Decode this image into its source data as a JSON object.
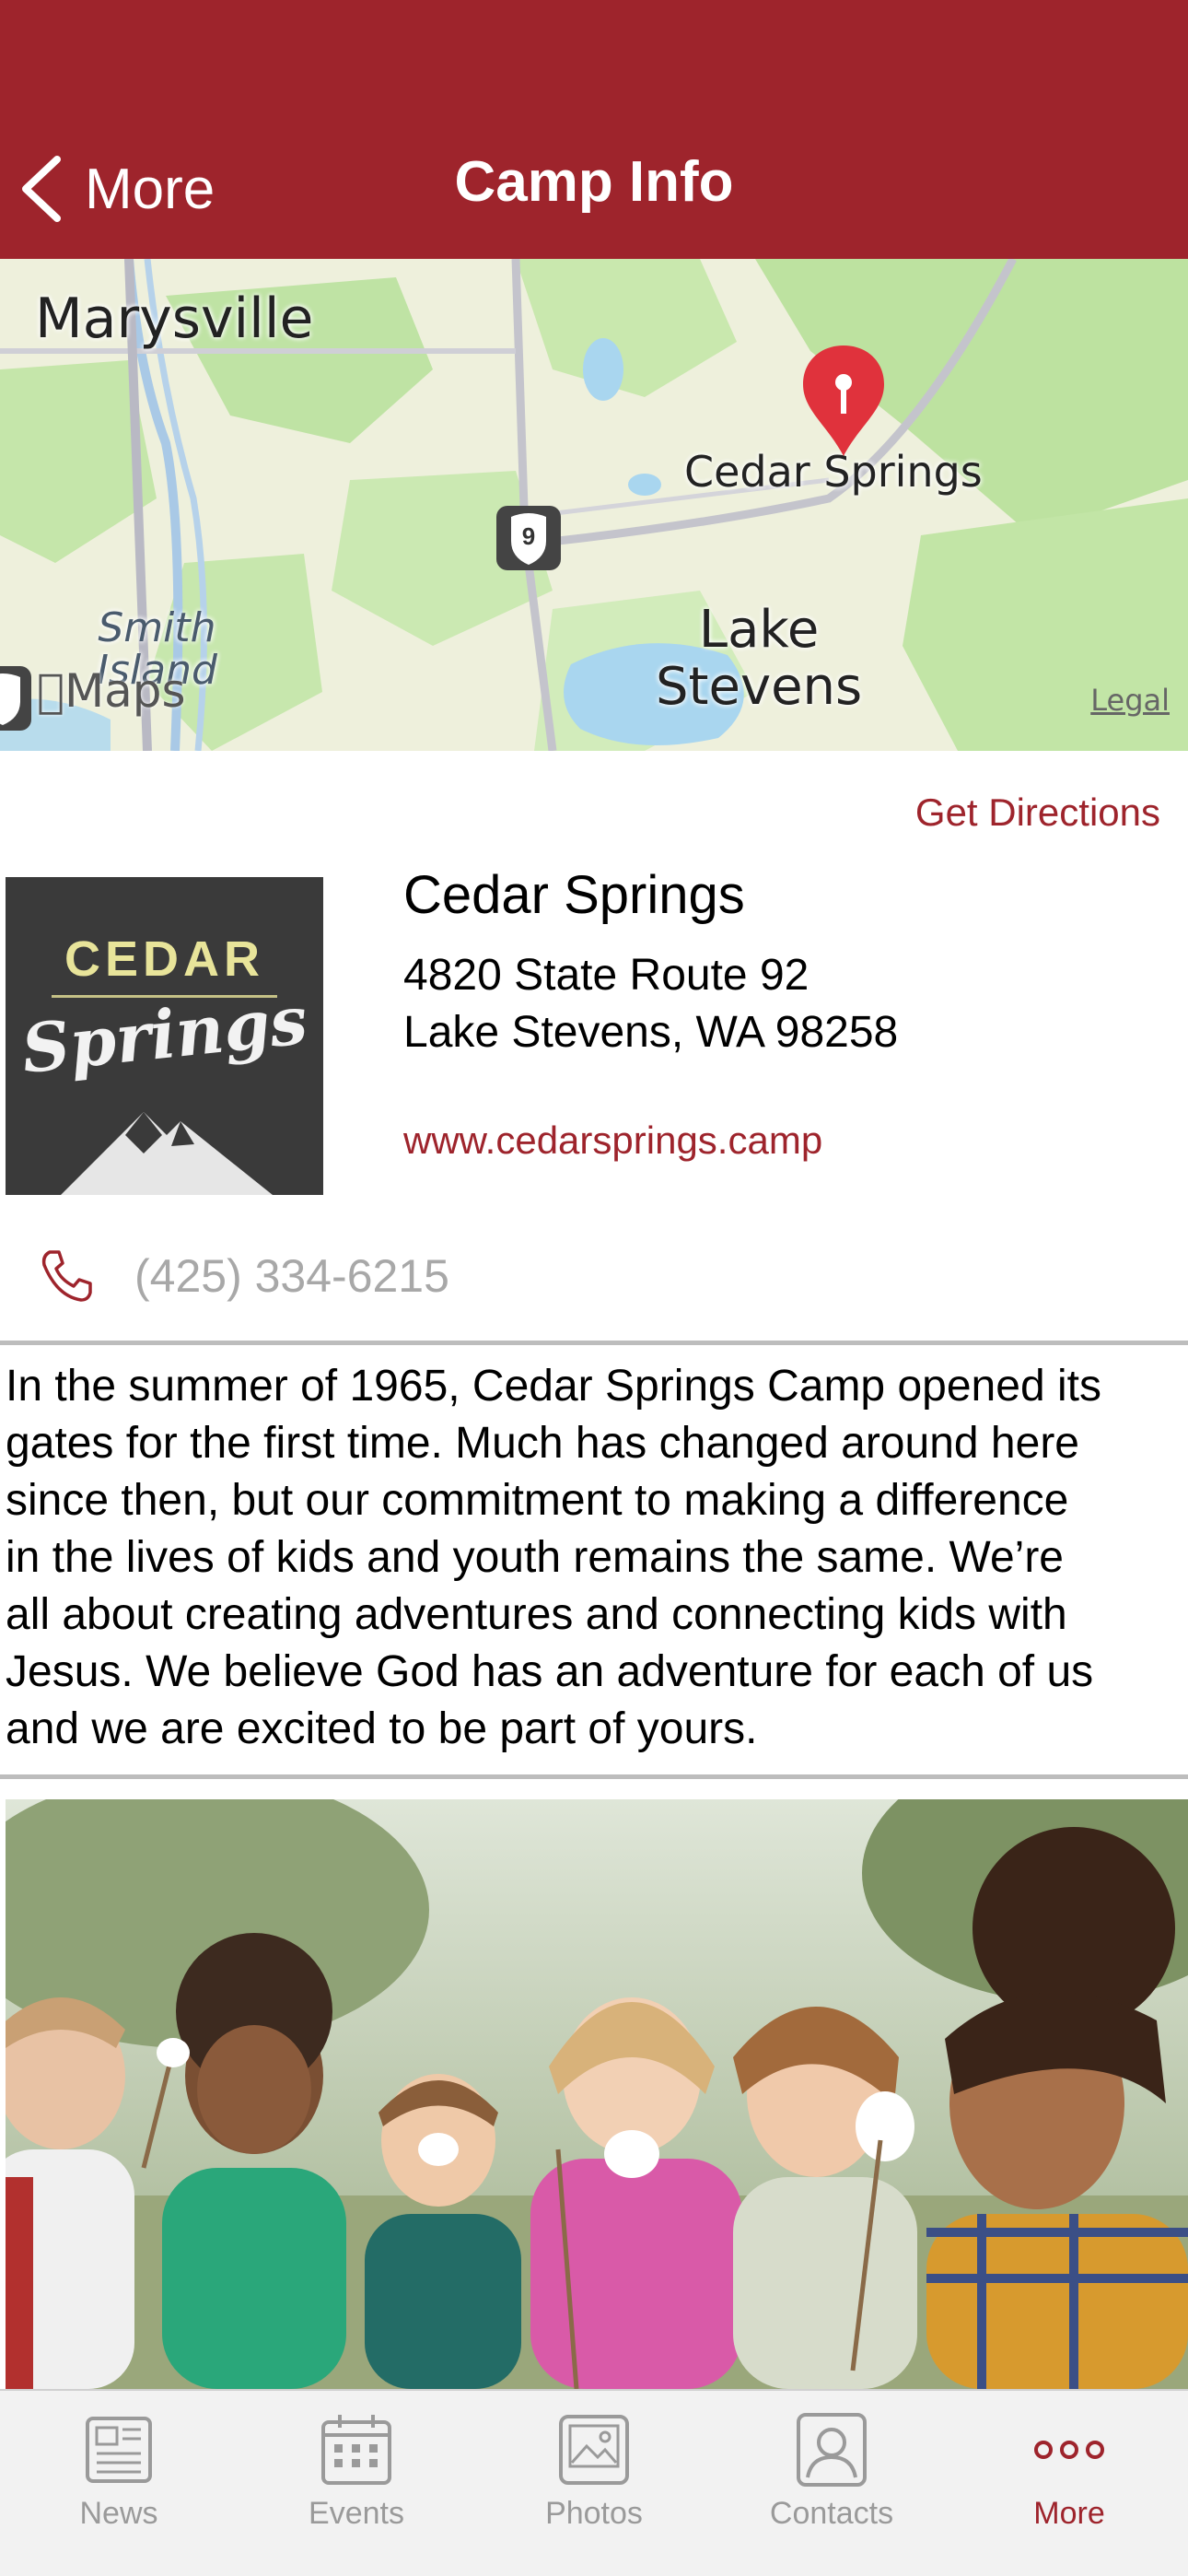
{
  "header": {
    "back_label": "More",
    "title": "Camp Info"
  },
  "map": {
    "labels": {
      "marysville": "Marysville",
      "cedar_springs": "Cedar Springs",
      "lake_stevens": "Lake\nStevens",
      "smith_island": "Smith\nIsland",
      "route": "9",
      "attribution": "Maps",
      "legal": "Legal"
    }
  },
  "info": {
    "get_directions": "Get Directions",
    "logo_top": "CEDAR",
    "logo_bottom": "Springs",
    "name": "Cedar Springs",
    "address_line1": "4820 State Route 92",
    "address_line2": "Lake Stevens, WA 98258",
    "website": "www.cedarsprings.camp",
    "phone": "(425) 334-6215"
  },
  "description": {
    "lines": [
      "In the summer of 1965, Cedar Springs Camp opened its",
      "gates for the first time. Much has changed around here",
      "since then, but our commitment to making a difference",
      "in the lives of kids and youth remains the same. We’re",
      "all about creating adventures and connecting kids with",
      "Jesus. We believe God has an adventure for each of us",
      "and we are excited to be part of yours."
    ]
  },
  "tabs": [
    {
      "label": "News",
      "icon": "newspaper-icon"
    },
    {
      "label": "Events",
      "icon": "calendar-icon"
    },
    {
      "label": "Photos",
      "icon": "photo-icon"
    },
    {
      "label": "Contacts",
      "icon": "contact-icon"
    },
    {
      "label": "More",
      "icon": "more-dots-icon"
    }
  ],
  "colors": {
    "brand": "#9e242c",
    "tab_inactive": "#9a9a9a",
    "phone_text": "#a8a8a8"
  }
}
